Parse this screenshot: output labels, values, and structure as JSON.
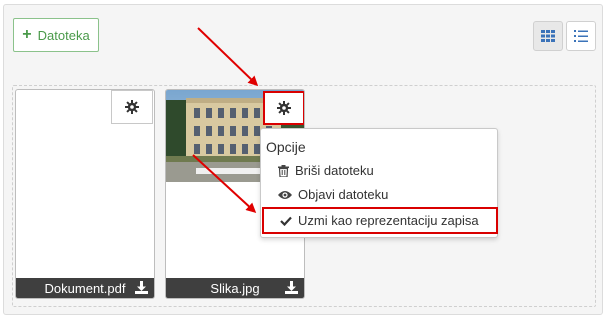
{
  "toolbar": {
    "add_label": "Datoteka",
    "grid_icon": "grid-view-icon",
    "list_icon": "list-view-icon"
  },
  "files": [
    {
      "name": "Dokument.pdf",
      "thumb": "none",
      "download_icon": "download-icon",
      "gear_icon": "gear-icon"
    },
    {
      "name": "Slika.jpg",
      "thumb": "building-photo",
      "download_icon": "download-icon",
      "gear_icon": "gear-icon"
    }
  ],
  "menu": {
    "title": "Opcije",
    "items": [
      {
        "label": "Briši datoteku",
        "icon": "trash-icon"
      },
      {
        "label": "Objavi datoteku",
        "icon": "eye-icon"
      },
      {
        "label": "Uzmi kao reprezentaciju zapisa",
        "icon": "check-icon"
      }
    ]
  },
  "colors": {
    "highlight": "#d90000",
    "add_button": "#4a9a4a",
    "footer": "#3f3f3f"
  }
}
